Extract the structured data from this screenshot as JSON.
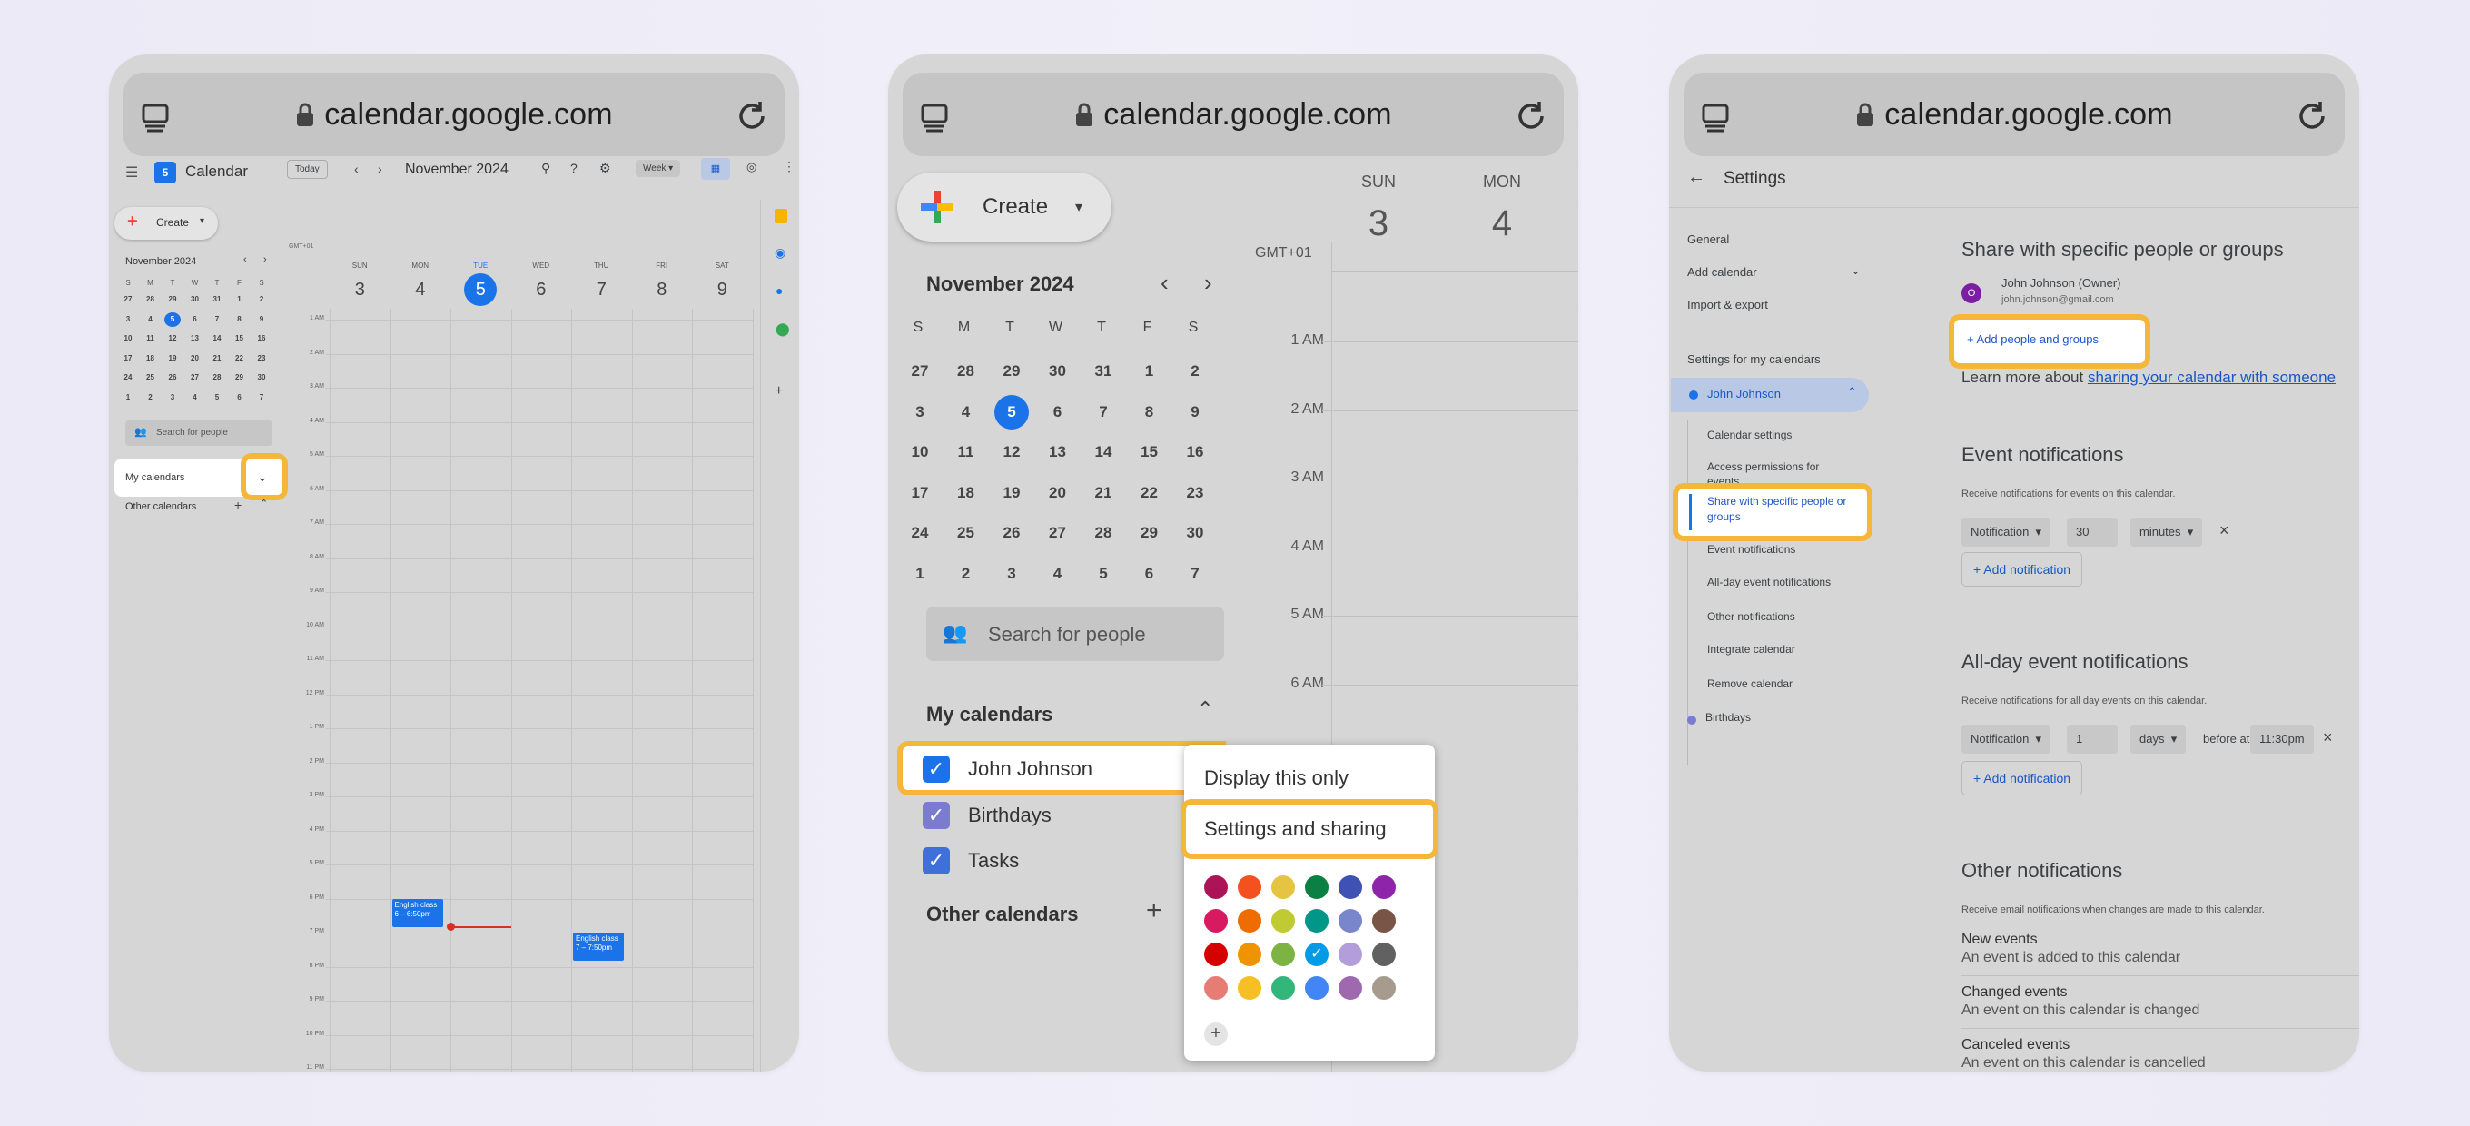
{
  "accent": "#f4b73a",
  "brand_blue": "#1a73e8",
  "p1": {
    "url": "calendar.google.com",
    "app_title": "Calendar",
    "today_btn": "Today",
    "month_label": "November 2024",
    "view_select": "Week",
    "create_label": "Create",
    "mini_title": "November 2024",
    "mini_days": [
      "S",
      "M",
      "T",
      "W",
      "T",
      "F",
      "S"
    ],
    "mini_weeks": [
      [
        "27",
        "28",
        "29",
        "30",
        "31",
        "1",
        "2"
      ],
      [
        "3",
        "4",
        "5",
        "6",
        "7",
        "8",
        "9"
      ],
      [
        "10",
        "11",
        "12",
        "13",
        "14",
        "15",
        "16"
      ],
      [
        "17",
        "18",
        "19",
        "20",
        "21",
        "22",
        "23"
      ],
      [
        "24",
        "25",
        "26",
        "27",
        "28",
        "29",
        "30"
      ],
      [
        "1",
        "2",
        "3",
        "4",
        "5",
        "6",
        "7"
      ]
    ],
    "search_people": "Search for people",
    "my_calendars": "My calendars",
    "other_calendars": "Other calendars",
    "tz": "GMT+01",
    "days": [
      {
        "name": "SUN",
        "num": "3"
      },
      {
        "name": "MON",
        "num": "4"
      },
      {
        "name": "TUE",
        "num": "5"
      },
      {
        "name": "WED",
        "num": "6"
      },
      {
        "name": "THU",
        "num": "7"
      },
      {
        "name": "FRI",
        "num": "8"
      },
      {
        "name": "SAT",
        "num": "9"
      }
    ],
    "hours": [
      "1 AM",
      "2 AM",
      "3 AM",
      "4 AM",
      "5 AM",
      "6 AM",
      "7 AM",
      "8 AM",
      "9 AM",
      "10 AM",
      "11 AM",
      "12 PM",
      "1 PM",
      "2 PM",
      "3 PM",
      "4 PM",
      "5 PM",
      "6 PM",
      "7 PM",
      "8 PM",
      "9 PM",
      "10 PM",
      "11 PM"
    ],
    "event1": {
      "title": "English class",
      "time": "6 – 6:50pm"
    },
    "event2": {
      "title": "English class",
      "time": "7 – 7:50pm"
    }
  },
  "p2": {
    "url": "calendar.google.com",
    "create_label": "Create",
    "day1": {
      "name": "SUN",
      "num": "3"
    },
    "day2": {
      "name": "MON",
      "num": "4"
    },
    "tz": "GMT+01",
    "hours": [
      "1 AM",
      "2 AM",
      "3 AM",
      "4 AM",
      "5 AM",
      "6 AM"
    ],
    "mini_title": "November 2024",
    "mini_days": [
      "S",
      "M",
      "T",
      "W",
      "T",
      "F",
      "S"
    ],
    "mini_weeks": [
      [
        "27",
        "28",
        "29",
        "30",
        "31",
        "1",
        "2"
      ],
      [
        "3",
        "4",
        "5",
        "6",
        "7",
        "8",
        "9"
      ],
      [
        "10",
        "11",
        "12",
        "13",
        "14",
        "15",
        "16"
      ],
      [
        "17",
        "18",
        "19",
        "20",
        "21",
        "22",
        "23"
      ],
      [
        "24",
        "25",
        "26",
        "27",
        "28",
        "29",
        "30"
      ],
      [
        "1",
        "2",
        "3",
        "4",
        "5",
        "6",
        "7"
      ]
    ],
    "search_people": "Search for people",
    "my_calendars": "My calendars",
    "calendars": [
      {
        "label": "John Johnson",
        "color": "#1a73e8"
      },
      {
        "label": "Birthdays",
        "color": "#7b7bd0"
      },
      {
        "label": "Tasks",
        "color": "#3f6fd8"
      }
    ],
    "other_calendars": "Other calendars",
    "menu": {
      "display_only": "Display this only",
      "settings_sharing": "Settings and sharing"
    },
    "swatches": [
      "#ad1457",
      "#f4511e",
      "#e4c441",
      "#0b8043",
      "#3f51b5",
      "#8e24aa",
      "#d81b60",
      "#ef6c00",
      "#c0ca33",
      "#009688",
      "#7986cb",
      "#795548",
      "#d50000",
      "#f09300",
      "#7cb342",
      "#039be5",
      "#b39ddb",
      "#616161",
      "#e67c73",
      "#f6bf26",
      "#33b679",
      "#4285f4",
      "#9e69af",
      "#a79b8e"
    ]
  },
  "p3": {
    "url": "calendar.google.com",
    "title": "Settings",
    "nav": {
      "general": "General",
      "add_calendar": "Add calendar",
      "import_export": "Import & export",
      "settings_for_my": "Settings for my calendars",
      "john": "John Johnson",
      "calendar_settings": "Calendar settings",
      "access": "Access permissions for events",
      "share": "Share with specific people or groups",
      "event_notif": "Event notifications",
      "allday_notif": "All-day event notifications",
      "other_notif": "Other notifications",
      "integrate": "Integrate calendar",
      "remove": "Remove calendar",
      "birthdays": "Birthdays"
    },
    "share_heading": "Share with specific people or groups",
    "owner_avatar": "O",
    "owner_name": "John Johnson (Owner)",
    "owner_email": "john.johnson@gmail.com",
    "add_people": "Add people and groups",
    "learn_more": "Learn more about",
    "learn_link": "sharing your calendar with someone",
    "event_notif_heading": "Event notifications",
    "event_notif_desc": "Receive notifications for events on this calendar.",
    "notif_type": "Notification",
    "notif_value": "30",
    "notif_unit": "minutes",
    "add_notification": "Add notification",
    "allday_heading": "All-day event notifications",
    "allday_desc": "Receive notifications for all day events on this calendar.",
    "allday_value": "1",
    "allday_unit": "days",
    "before_at": "before at",
    "allday_time": "11:30pm",
    "other_heading": "Other notifications",
    "other_desc": "Receive email notifications when changes are made to this calendar.",
    "new_events": "New events",
    "new_events_desc": "An event is added to this calendar",
    "changed_events": "Changed events",
    "changed_events_desc": "An event on this calendar is changed",
    "canceled_events": "Canceled events",
    "canceled_events_desc": "An event on this calendar is cancelled"
  }
}
